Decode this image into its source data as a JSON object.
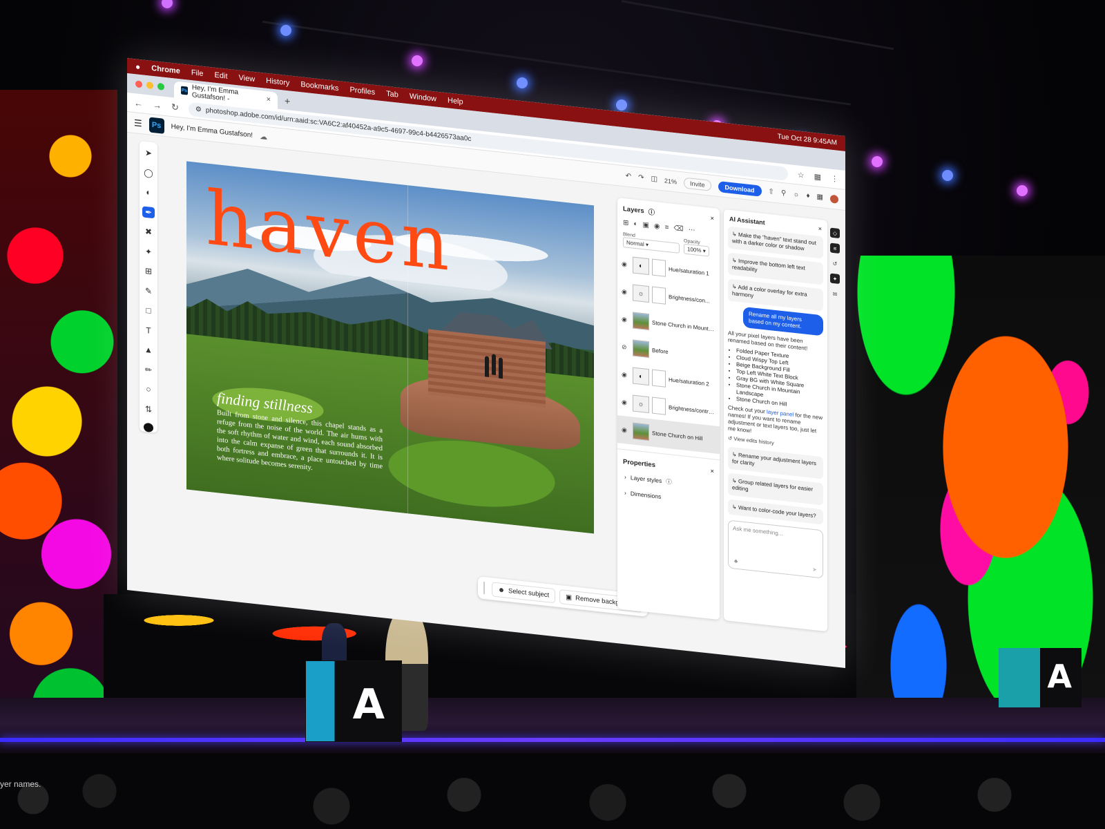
{
  "mac_menubar": {
    "app": "Chrome",
    "menus": [
      "File",
      "Edit",
      "View",
      "History",
      "Bookmarks",
      "Profiles",
      "Tab",
      "Window",
      "Help"
    ],
    "clock": "Tue Oct 28 9:45AM"
  },
  "browser": {
    "tab_title": "Hey, I'm Emma Gustafson! -",
    "url": "photoshop.adobe.com/id/urn:aaid:sc:VA6C2:af40452a-a9c5-4697-99c4-b4426573aa0c"
  },
  "photoshop": {
    "logo": "Ps",
    "document_title": "Hey, I'm Emma Gustafson!",
    "zoom": "21%",
    "invite_label": "Invite",
    "download_label": "Download",
    "canvas": {
      "headline": "haven",
      "subhead": "finding stillness",
      "body": "Built from stone and silence, this chapel stands as a refuge from the noise of the world. The air hums with the soft rhythm of water and wind, each sound absorbed into the calm expanse of green that surrounds it. It is both fortress and embrace, a place untouched by time where solitude becomes serenity."
    },
    "context_bar": {
      "select_subject": "Select subject",
      "remove_background": "Remove background"
    },
    "layers_panel": {
      "title": "Layers",
      "blend_label": "Blend",
      "blend_value": "Normal",
      "opacity_label": "Opacity",
      "opacity_value": "100%",
      "layers": [
        {
          "name": "Hue/saturation 1"
        },
        {
          "name": "Brightness/con..."
        },
        {
          "name": "Stone Church in Mountain ..."
        },
        {
          "name": "Before"
        },
        {
          "name": "Hue/saturation 2"
        },
        {
          "name": "Brightness/contra..."
        },
        {
          "name": "Stone Church on Hill"
        }
      ]
    },
    "properties_panel": {
      "title": "Properties",
      "items": [
        "Layer styles",
        "Dimensions"
      ]
    },
    "ai_assistant": {
      "title": "AI Assistant",
      "suggestions_top": [
        "Make the \"haven\" text stand out with a darker color or shadow",
        "Improve the bottom left text readability",
        "Add a color overlay for extra harmony"
      ],
      "user_message": "Rename all my layers based on my content.",
      "reply_intro": "All your pixel layers have been renamed based on their content!",
      "renamed_layers": [
        "Folded Paper Texture",
        "Cloud Wispy Top Left",
        "Beige Background Fill",
        "Top Left White Text Block",
        "Gray BG with White Square",
        "Stone Church in Mountain Landscape",
        "Stone Church on Hill"
      ],
      "reply_outro_pre": "Check out your ",
      "reply_outro_link": "layer panel",
      "reply_outro_post": " for the new names! If you want to rename adjustment or text layers too, just let me know!",
      "view_history": "View edits history",
      "suggestions_bottom": [
        "Rename your adjustment layers for clarity",
        "Group related layers for easier editing",
        "Want to color-code your layers?"
      ],
      "prompt_placeholder": "Ask me something..."
    }
  },
  "stage": {
    "caption_fragment": "yer names."
  },
  "colors": {
    "menubar": "#8a1111",
    "accent_blue": "#1d5fe8",
    "headline_orange": "#ff4a14",
    "ps_dark": "#001e36"
  }
}
